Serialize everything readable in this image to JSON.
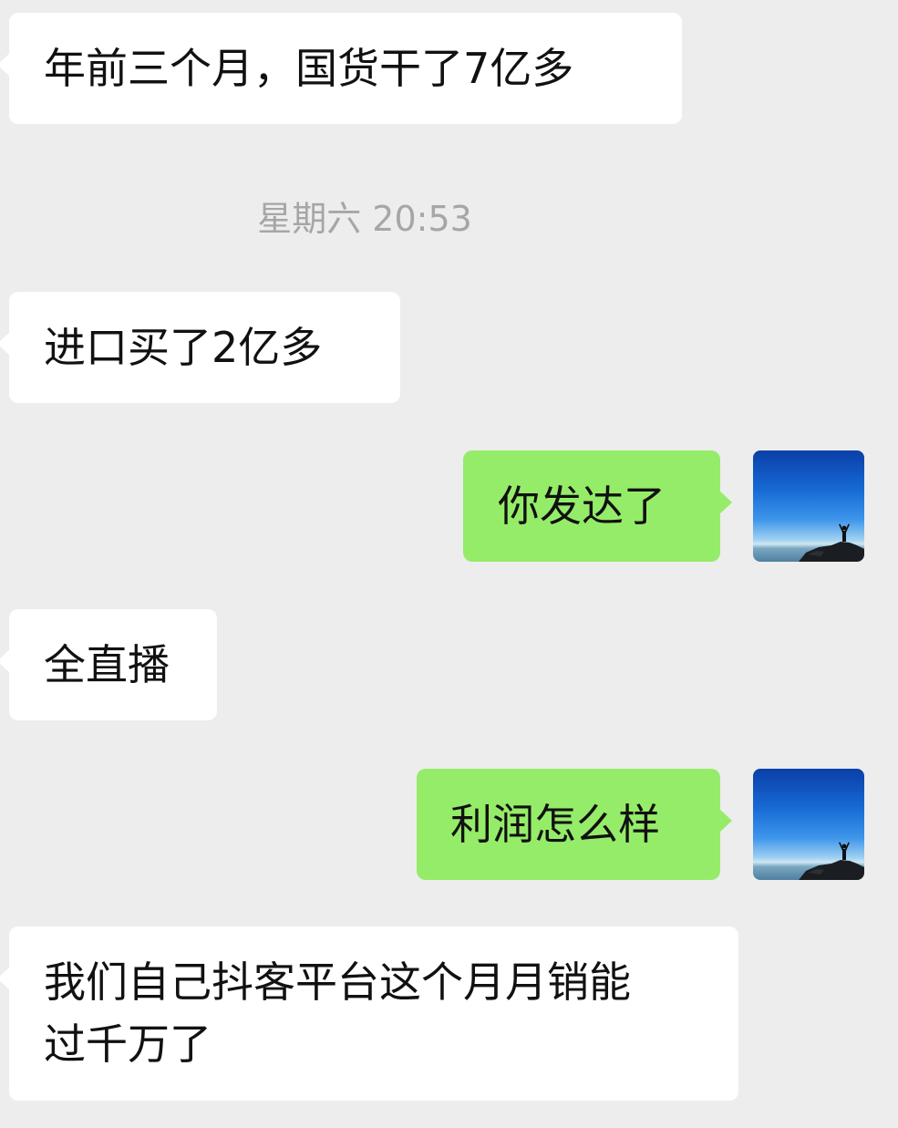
{
  "conversation": {
    "timestamp": "星期六 20:53",
    "messages": [
      {
        "sender": "other",
        "text": "年前三个月，国货干了7亿多"
      },
      {
        "sender": "other",
        "text": "进口买了2亿多"
      },
      {
        "sender": "me",
        "text": "你发达了"
      },
      {
        "sender": "other",
        "text": "全直播"
      },
      {
        "sender": "me",
        "text": "利润怎么样"
      },
      {
        "sender": "other",
        "lines": [
          "我们自己抖客平台这个月月销能",
          "过千万了"
        ]
      }
    ]
  },
  "colors": {
    "background": "#ededed",
    "incoming_bubble": "#ffffff",
    "outgoing_bubble": "#95ec69",
    "timestamp_text": "#a6a6a6"
  },
  "icons": {
    "avatar": "person-on-rocks-avatar"
  }
}
